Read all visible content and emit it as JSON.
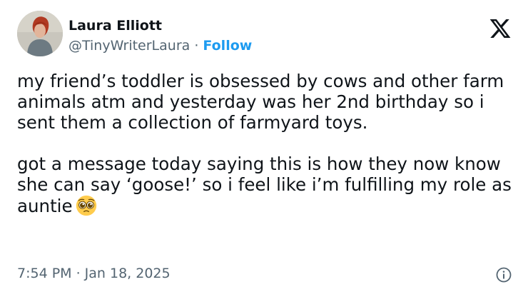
{
  "author": {
    "name": "Laura Elliott",
    "handle": "@TinyWriterLaura",
    "separator": " · ",
    "follow_label": "Follow",
    "avatar_icon": "profile-photo"
  },
  "platform": {
    "logo_icon": "x-logo"
  },
  "post": {
    "paragraphs": [
      "my friend’s toddler is obsessed by cows and other farm animals atm and yesterday was her 2nd birthday so i sent them a collection of farmyard toys.",
      "got a message today saying this is how they now know she can say ‘goose!’ so i feel like i’m fulfilling my role as auntie"
    ],
    "emoji_icon": "pleading-face-emoji"
  },
  "timestamp": "7:54 PM · Jan 18, 2025",
  "info_icon": "info-icon",
  "colors": {
    "text": "#0f1419",
    "secondary": "#536471",
    "link": "#1d9bf0",
    "background": "#ffffff"
  }
}
